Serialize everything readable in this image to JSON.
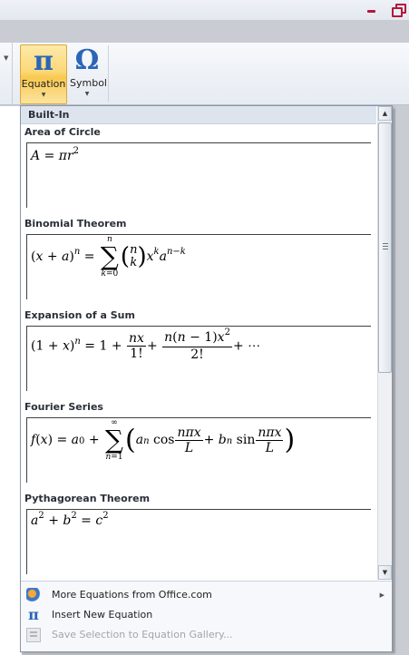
{
  "ribbon": {
    "equation_label": "Equation",
    "equation_glyph": "π",
    "symbol_label": "Symbol",
    "symbol_glyph": "Ω"
  },
  "gallery": {
    "section_header": "Built-In",
    "items": [
      {
        "title": "Area of Circle"
      },
      {
        "title": "Binomial Theorem"
      },
      {
        "title": "Expansion of a Sum"
      },
      {
        "title": "Fourier Series"
      },
      {
        "title": "Pythagorean Theorem"
      }
    ]
  },
  "menu": {
    "more_equations": "More Equations from Office.com",
    "insert_new": "Insert New Equation",
    "save_selection": "Save Selection to Equation Gallery..."
  },
  "colors": {
    "accent": "#2a65b8",
    "selected_button": "#fbd879"
  }
}
